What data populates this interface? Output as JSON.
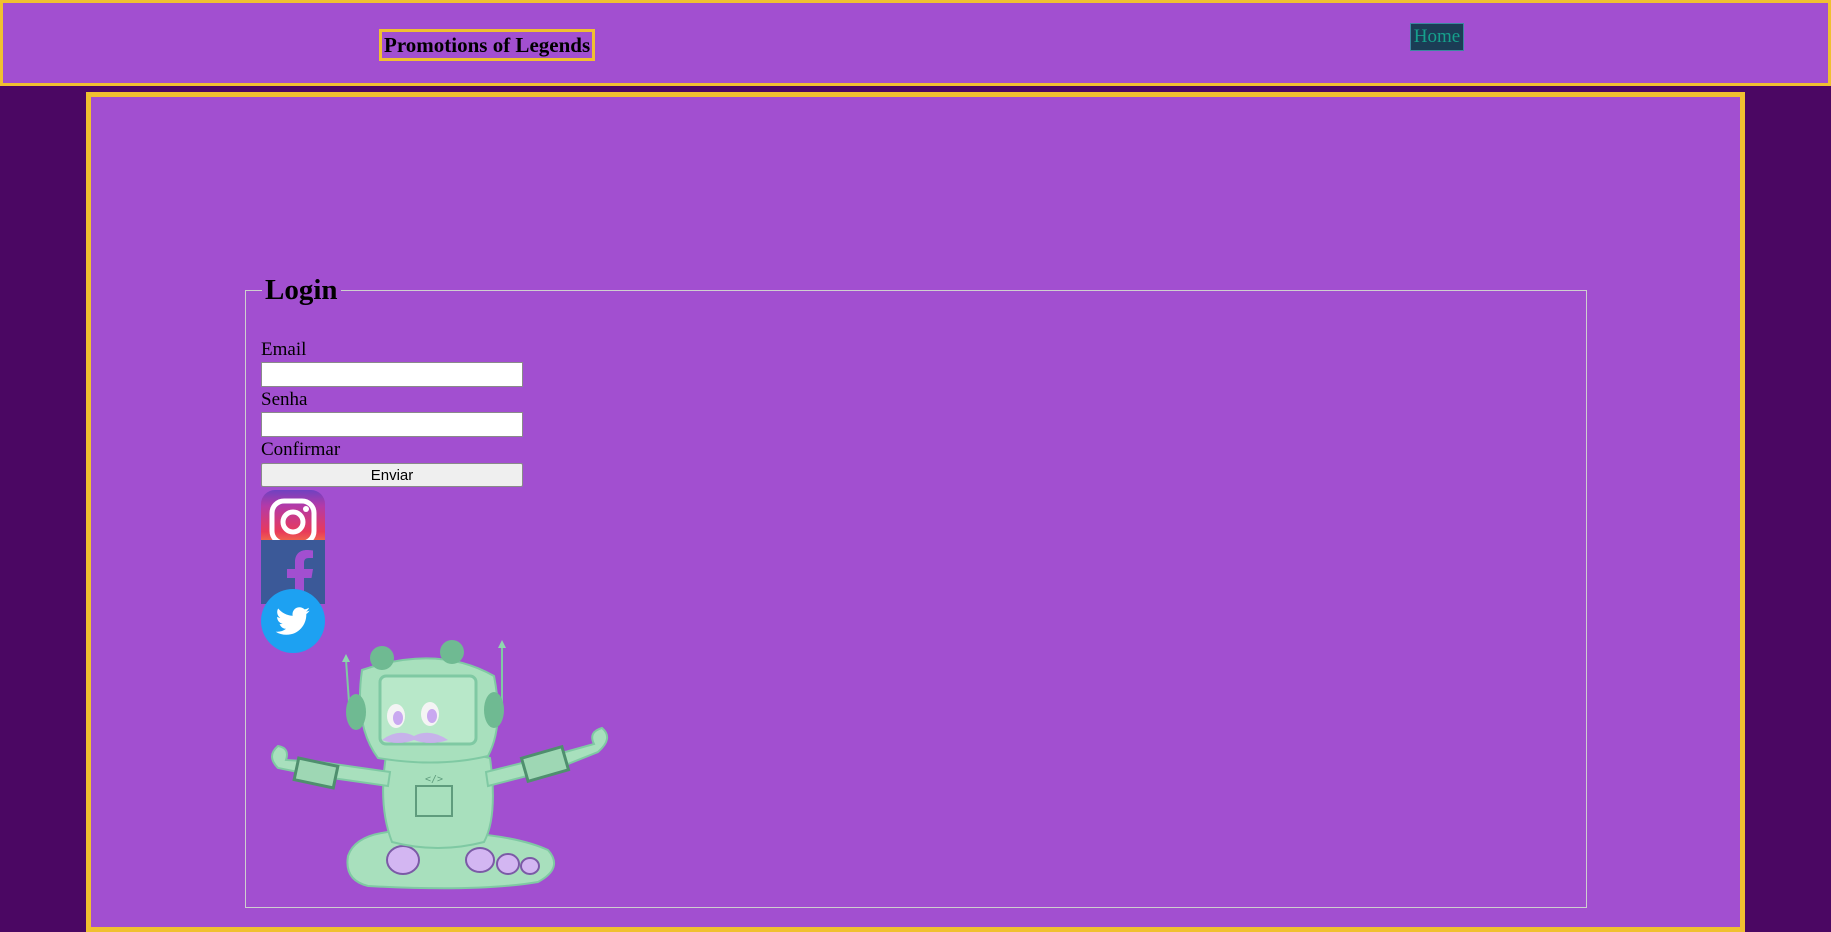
{
  "header": {
    "brand": "Promotions of Legends",
    "nav": {
      "home_label": "Home"
    }
  },
  "login": {
    "legend": "Login",
    "email_label": "Email",
    "email_value": "",
    "password_label": "Senha",
    "password_value": "",
    "confirm_label": "Confirmar",
    "submit_label": "Enviar"
  },
  "social": [
    {
      "icon": "instagram-icon"
    },
    {
      "icon": "facebook-icon"
    },
    {
      "icon": "twitter-icon"
    }
  ],
  "mascot": {
    "icon": "robot-mascot"
  },
  "colors": {
    "page_background": "#4b0763",
    "panel_background": "#a24fd0",
    "border_accent": "#f0c030",
    "home_background": "#1b3c55",
    "home_text": "#16a08c"
  }
}
